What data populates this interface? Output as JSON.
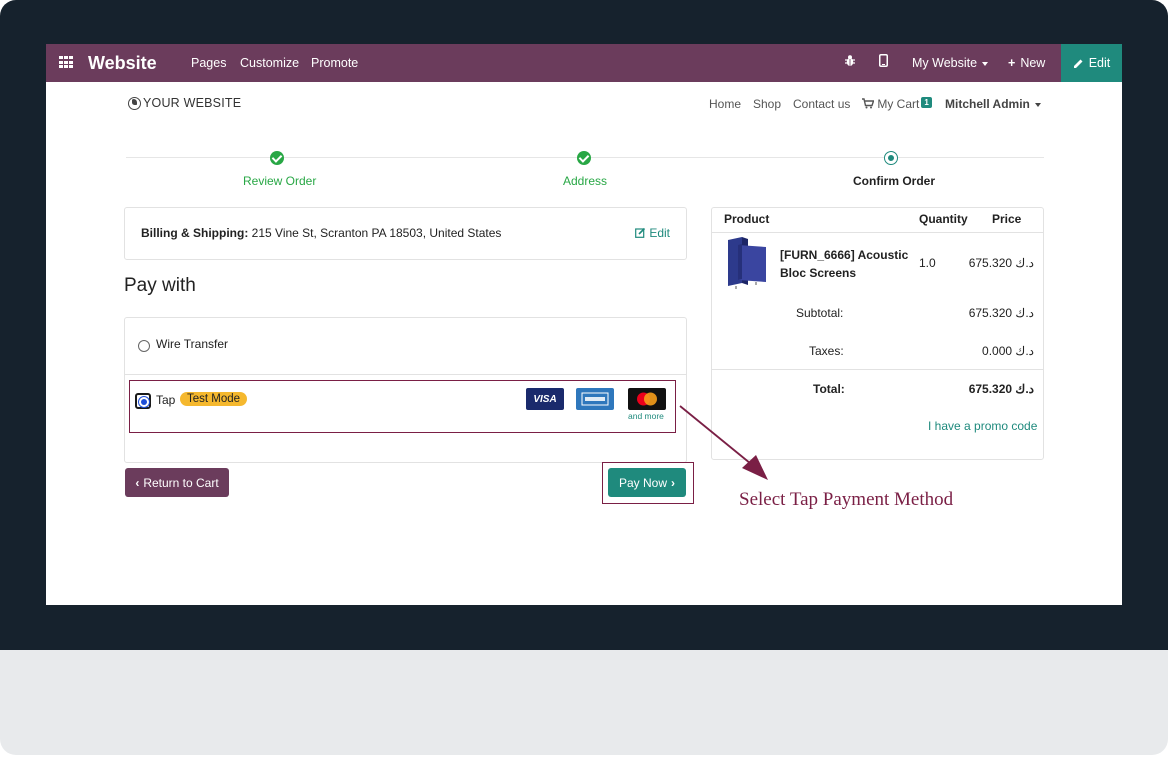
{
  "topbar": {
    "brand": "Website",
    "menu": [
      "Pages",
      "Customize",
      "Promote"
    ],
    "site_selector": "My Website",
    "new_label": "New",
    "edit_label": "Edit"
  },
  "site_header": {
    "logo_text": "YOUR WEBSITE",
    "nav": [
      "Home",
      "Shop",
      "Contact us"
    ],
    "cart_label": "My Cart",
    "cart_count": "1",
    "user": "Mitchell Admin"
  },
  "steps": [
    {
      "label": "Review Order",
      "state": "done"
    },
    {
      "label": "Address",
      "state": "done"
    },
    {
      "label": "Confirm Order",
      "state": "current"
    }
  ],
  "billing": {
    "label": "Billing & Shipping:",
    "address": "215 Vine St, Scranton PA 18503, United States",
    "edit_label": "Edit"
  },
  "payment": {
    "heading": "Pay with",
    "methods": [
      {
        "label": "Wire Transfer",
        "selected": false
      },
      {
        "label": "Tap",
        "selected": true,
        "badge": "Test Mode"
      }
    ],
    "card_logos": [
      "VISA",
      "AMEX",
      "MasterCard"
    ],
    "and_more": "and more"
  },
  "buttons": {
    "return_label": "Return to Cart",
    "pay_label": "Pay Now"
  },
  "summary": {
    "columns": [
      "Product",
      "Quantity",
      "Price"
    ],
    "items": [
      {
        "name": "[FURN_6666] Acoustic Bloc Screens",
        "qty": "1.0",
        "price": "675.320 د.ك"
      }
    ],
    "subtotal_label": "Subtotal:",
    "subtotal": "675.320 د.ك",
    "taxes_label": "Taxes:",
    "taxes": "0.000 د.ك",
    "total_label": "Total:",
    "total": "675.320 د.ك",
    "promo_label": "I have a promo code"
  },
  "annotation": "Select Tap Payment Method",
  "colors": {
    "topbar": "#6b3c5c",
    "accent": "#1f8a7d",
    "success": "#28a745",
    "badge": "#f5b82e",
    "highlight": "#7a1f45"
  }
}
